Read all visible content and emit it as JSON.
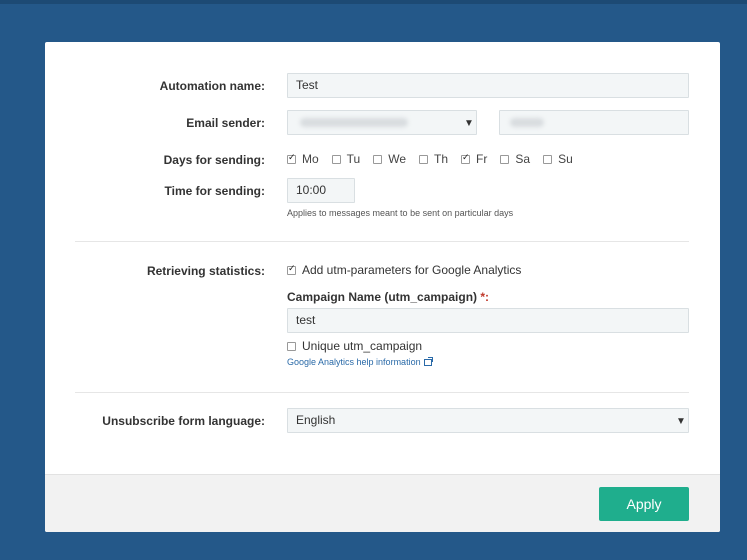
{
  "form": {
    "automation_name_label": "Automation name:",
    "automation_name_value": "Test",
    "email_sender_label": "Email sender:",
    "days_label": "Days for sending:",
    "days": [
      {
        "label": "Mo",
        "checked": true
      },
      {
        "label": "Tu",
        "checked": false
      },
      {
        "label": "We",
        "checked": false
      },
      {
        "label": "Th",
        "checked": false
      },
      {
        "label": "Fr",
        "checked": true
      },
      {
        "label": "Sa",
        "checked": false
      },
      {
        "label": "Su",
        "checked": false
      }
    ],
    "time_label": "Time for sending:",
    "time_value": "10:00",
    "time_hint": "Applies to messages meant to be sent on particular days",
    "stats_label": "Retrieving statistics:",
    "utm_checkbox_label": "Add utm-parameters for Google Analytics",
    "utm_checked": true,
    "campaign_label": "Campaign Name (utm_campaign)",
    "campaign_required_mark": "*:",
    "campaign_value": "test",
    "unique_label": "Unique utm_campaign",
    "unique_checked": false,
    "ga_help_link": "Google Analytics help information",
    "language_label": "Unsubscribe form language:",
    "language_value": "English"
  },
  "footer": {
    "apply_label": "Apply"
  },
  "colors": {
    "background": "#245889",
    "apply_button": "#1fae8d",
    "link": "#2a6aa8",
    "required": "#c0392b"
  }
}
